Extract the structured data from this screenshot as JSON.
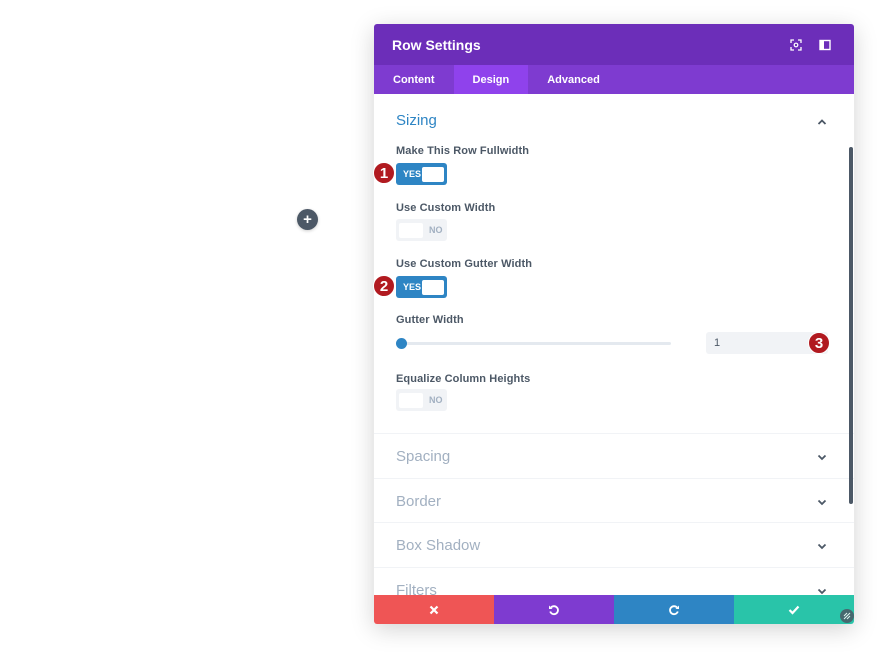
{
  "add_button": {
    "symbol": "+"
  },
  "modal": {
    "title": "Row Settings",
    "tabs": [
      {
        "label": "Content",
        "active": false
      },
      {
        "label": "Design",
        "active": true
      },
      {
        "label": "Advanced",
        "active": false
      }
    ]
  },
  "sizing": {
    "title": "Sizing",
    "fullwidth": {
      "label": "Make This Row Fullwidth",
      "state": "YES"
    },
    "custom_width": {
      "label": "Use Custom Width",
      "state": "NO"
    },
    "custom_gutter": {
      "label": "Use Custom Gutter Width",
      "state": "YES"
    },
    "gutter_width": {
      "label": "Gutter Width",
      "value": "1"
    },
    "equalize": {
      "label": "Equalize Column Heights",
      "state": "NO"
    }
  },
  "sections": [
    {
      "title": "Spacing"
    },
    {
      "title": "Border"
    },
    {
      "title": "Box Shadow"
    },
    {
      "title": "Filters"
    }
  ],
  "markers": [
    "1",
    "2",
    "3"
  ],
  "colors": {
    "header": "#6c2eb9",
    "tabs": "#7e3bd0",
    "accent": "#2e85c4",
    "marker": "#b11a20",
    "cancel": "#ef5555",
    "save": "#29c4a9"
  }
}
